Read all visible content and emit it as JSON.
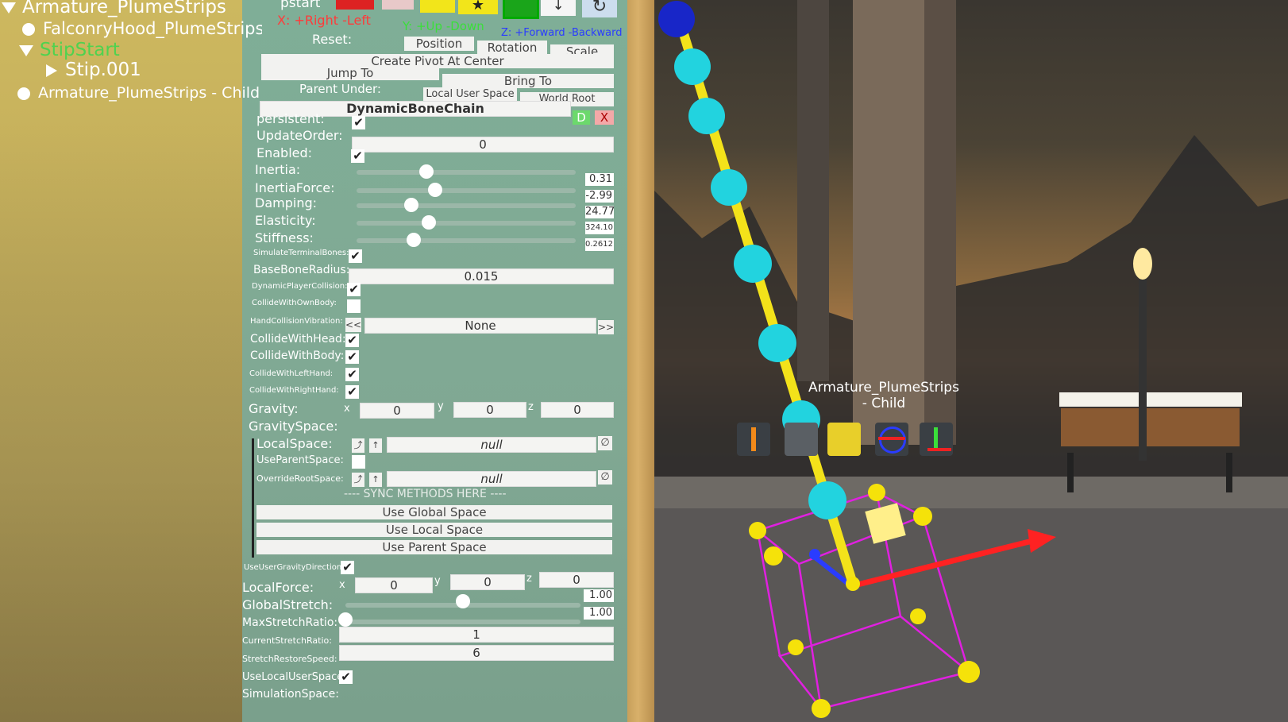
{
  "hierarchy": {
    "items": [
      {
        "label": "Armature_PlumeStrips"
      },
      {
        "label": "FalconryHood_PlumeStrips"
      },
      {
        "label": "StipStart"
      },
      {
        "label": "Stip.001"
      },
      {
        "label": "Armature_PlumeStrips - Child"
      }
    ]
  },
  "inspector": {
    "header_fragment": "pstart",
    "axis_x": "X: +Right -Left",
    "axis_y": "Y: +Up -Down",
    "axis_z": "Z: +Forward -Backward",
    "reset_label": "Reset:",
    "reset_position": "Position",
    "reset_rotation": "Rotation",
    "reset_scale": "Scale",
    "create_pivot": "Create Pivot At Center",
    "jump_to": "Jump To",
    "bring_to": "Bring To",
    "parent_under": "Parent Under:",
    "local_user_space": "Local User Space",
    "world_root": "World Root",
    "component_title": "DynamicBoneChain",
    "btn_d": "D",
    "btn_x": "X",
    "persistent": "persistent:",
    "update_order": "UpdateOrder:",
    "update_order_value": "0",
    "enabled": "Enabled:",
    "sliders": [
      {
        "label": "Inertia:",
        "value": "0.31",
        "fraction": 0.32
      },
      {
        "label": "InertiaForce:",
        "value": "-2.99",
        "fraction": 0.36
      },
      {
        "label": "Damping:",
        "value": "24.77",
        "fraction": 0.25
      },
      {
        "label": "Elasticity:",
        "value": "324.10",
        "fraction": 0.33
      },
      {
        "label": "Stiffness:",
        "value": "0.2612",
        "fraction": 0.26
      }
    ],
    "simulate_terminal": "SimulateTerminalBones:",
    "base_bone_radius": "BaseBoneRadius:",
    "base_bone_radius_value": "0.015",
    "dynamic_player_collision": "DynamicPlayerCollision:",
    "collide_own_body": "CollideWithOwnBody:",
    "hand_collision_vibration": "HandCollisionVibration:",
    "hcv_prev": "<<",
    "hcv_value": "None",
    "hcv_next": ">>",
    "collide_head": "CollideWithHead:",
    "collide_body": "CollideWithBody:",
    "collide_left": "CollideWithLeftHand:",
    "collide_right": "CollideWithRightHand:",
    "gravity": "Gravity:",
    "gravity_x": "0",
    "gravity_y": "0",
    "gravity_z": "0",
    "x": "x",
    "y": "y",
    "z": "z",
    "gravity_space": "GravitySpace:",
    "local_space": "LocalSpace:",
    "local_space_value": "null",
    "use_parent_space": "UseParentSpace:",
    "override_root_space": "OverrideRootSpace:",
    "override_root_value": "null",
    "null_icon": "∅",
    "sync_methods": "---- SYNC METHODS HERE ----",
    "use_global": "Use Global Space",
    "use_local": "Use Local Space",
    "use_parent": "Use Parent Space",
    "use_user_gravity": "UseUserGravityDirection:",
    "local_force": "LocalForce:",
    "lf_x": "0",
    "lf_y": "0",
    "lf_z": "0",
    "global_stretch": "GlobalStretch:",
    "global_stretch_value": "1.00",
    "global_stretch_fraction": 0.5,
    "max_stretch": "MaxStretchRatio:",
    "max_stretch_value": "1.00",
    "max_stretch_fraction": 0.0,
    "current_stretch": "CurrentStretchRatio:",
    "current_stretch_value": "1",
    "stretch_restore": "StretchRestoreSpeed:",
    "stretch_restore_value": "6",
    "use_local_user_space": "UseLocalUserSpace:",
    "simulation_space": "SimulationSpace:"
  },
  "scene": {
    "object_label_line1": "Armature_PlumeStrips",
    "object_label_line2": "- Child"
  },
  "colors": {
    "axis_x": "#ff3030",
    "axis_y": "#3adf3a",
    "axis_z": "#2a3cff",
    "bone": "#f3e21a",
    "joint": "#22d3df",
    "gizmo": "#e020e0"
  },
  "icons": [
    "trash-icon",
    "star-icon",
    "arrow-down-icon",
    "refresh-icon",
    "checkmark-icon",
    "move-arrow-icon",
    "rotate-gizmo-icon",
    "scale-gizmo-icon"
  ]
}
